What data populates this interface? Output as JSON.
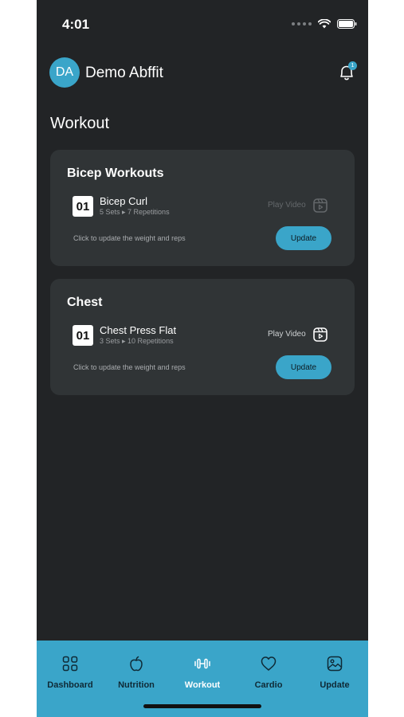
{
  "status_bar": {
    "time": "4:01"
  },
  "header": {
    "avatar_initials": "DA",
    "user_name": "Demo Abffit",
    "notification_count": "1"
  },
  "page_title": "Workout",
  "workouts": [
    {
      "title": "Bicep Workouts",
      "exercise": {
        "number": "01",
        "name": "Bicep Curl",
        "meta": "5 Sets ▸ 7 Repetitions"
      },
      "play_video_label": "Play Video",
      "hint": "Click to update the weight and reps",
      "update_label": "Update"
    },
    {
      "title": "Chest",
      "exercise": {
        "number": "01",
        "name": "Chest Press Flat",
        "meta": "3 Sets ▸ 10 Repetitions"
      },
      "play_video_label": "Play Video",
      "hint": "Click to update the weight and reps",
      "update_label": "Update"
    }
  ],
  "bottom_nav": {
    "items": [
      {
        "label": "Dashboard",
        "icon": "grid-icon"
      },
      {
        "label": "Nutrition",
        "icon": "apple-icon"
      },
      {
        "label": "Workout",
        "icon": "dumbbell-icon",
        "active": true
      },
      {
        "label": "Cardio",
        "icon": "heart-icon"
      },
      {
        "label": "Update",
        "icon": "image-icon"
      }
    ]
  },
  "colors": {
    "accent": "#3aa5c9",
    "background": "#222426",
    "card": "#303436"
  }
}
